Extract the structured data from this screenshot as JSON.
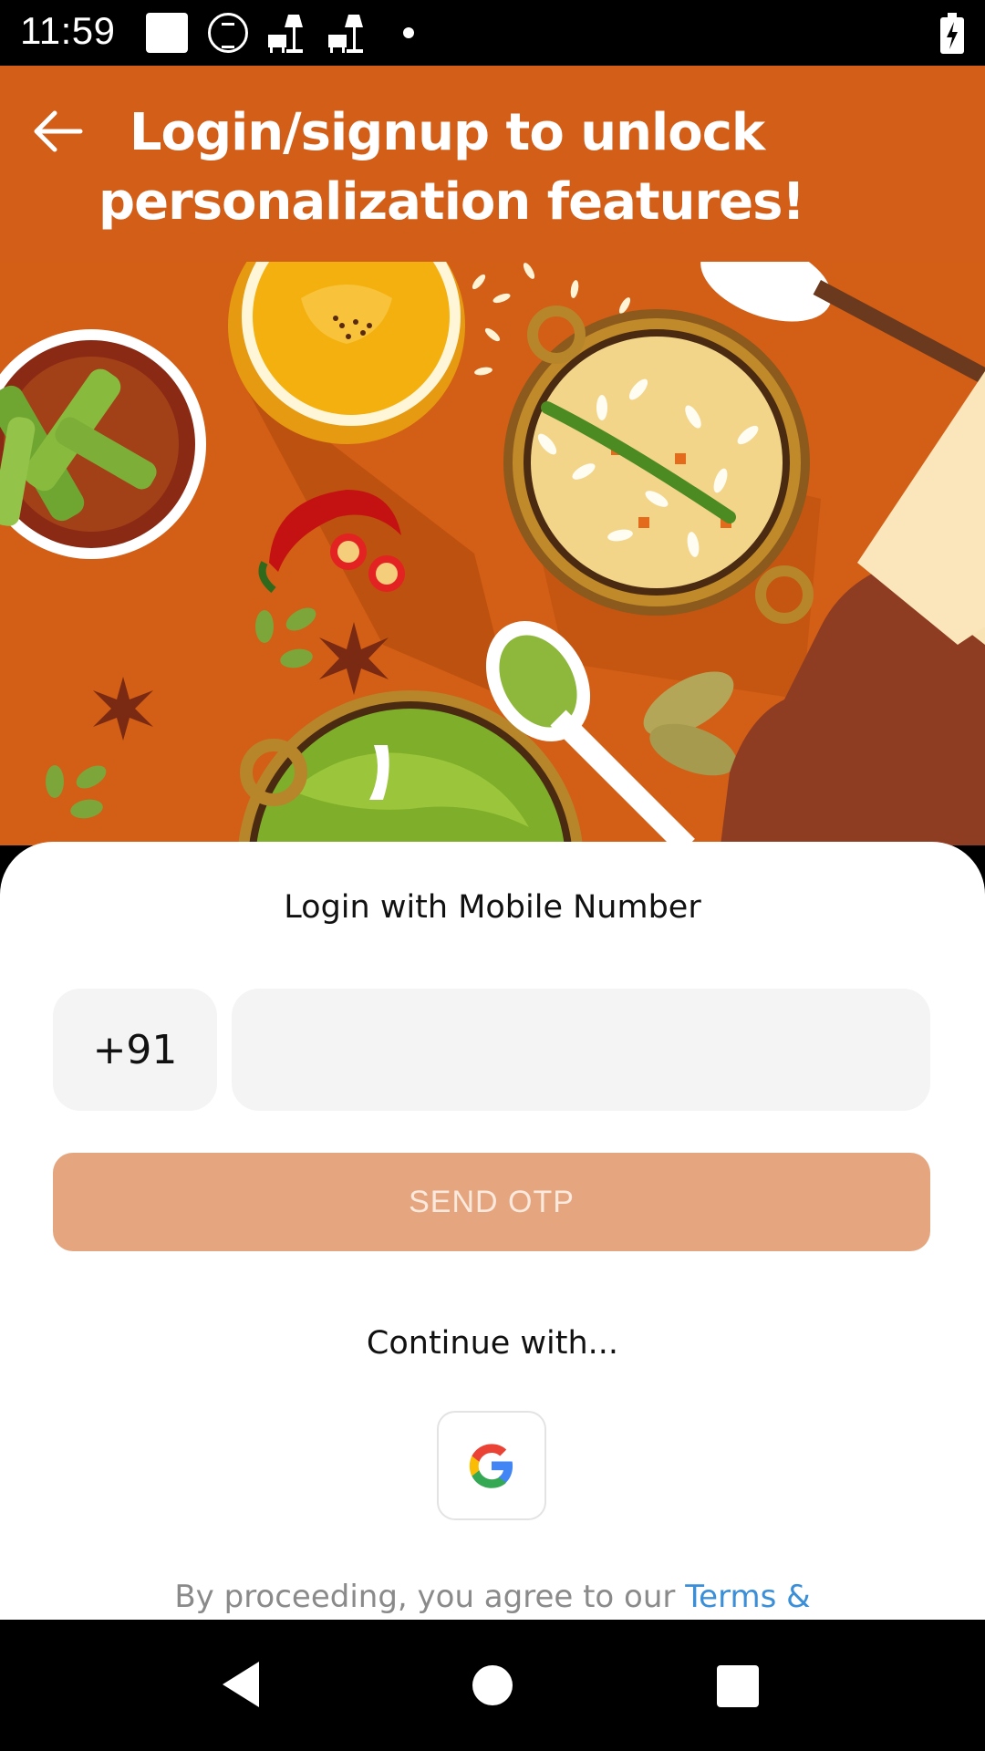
{
  "status_bar": {
    "time": "11:59",
    "icons": [
      "notification-square-icon",
      "timer-icon",
      "lamp-icon",
      "lamp-icon",
      "dot-icon",
      "battery-charging-icon"
    ]
  },
  "header": {
    "back_icon": "arrow-left-icon",
    "title_line1": "Login/signup to unlock",
    "title_line2": "personalization features!",
    "background_color": "#D25E18"
  },
  "illustration": {
    "description_icon": "indian-food-illustration"
  },
  "login": {
    "heading": "Login with Mobile Number",
    "country_code": "+91",
    "phone_value": "",
    "phone_placeholder": "",
    "send_otp_label": "SEND OTP",
    "send_otp_color": "#E5A67F"
  },
  "social": {
    "continue_label": "Continue with...",
    "google_icon": "google-logo-icon"
  },
  "terms": {
    "prefix": "By proceeding, you agree to our ",
    "link": "Terms &",
    "link_color": "#3A8FD8"
  },
  "nav_bar": {
    "back": "back-triangle-icon",
    "home": "home-circle-icon",
    "recents": "recents-square-icon"
  }
}
